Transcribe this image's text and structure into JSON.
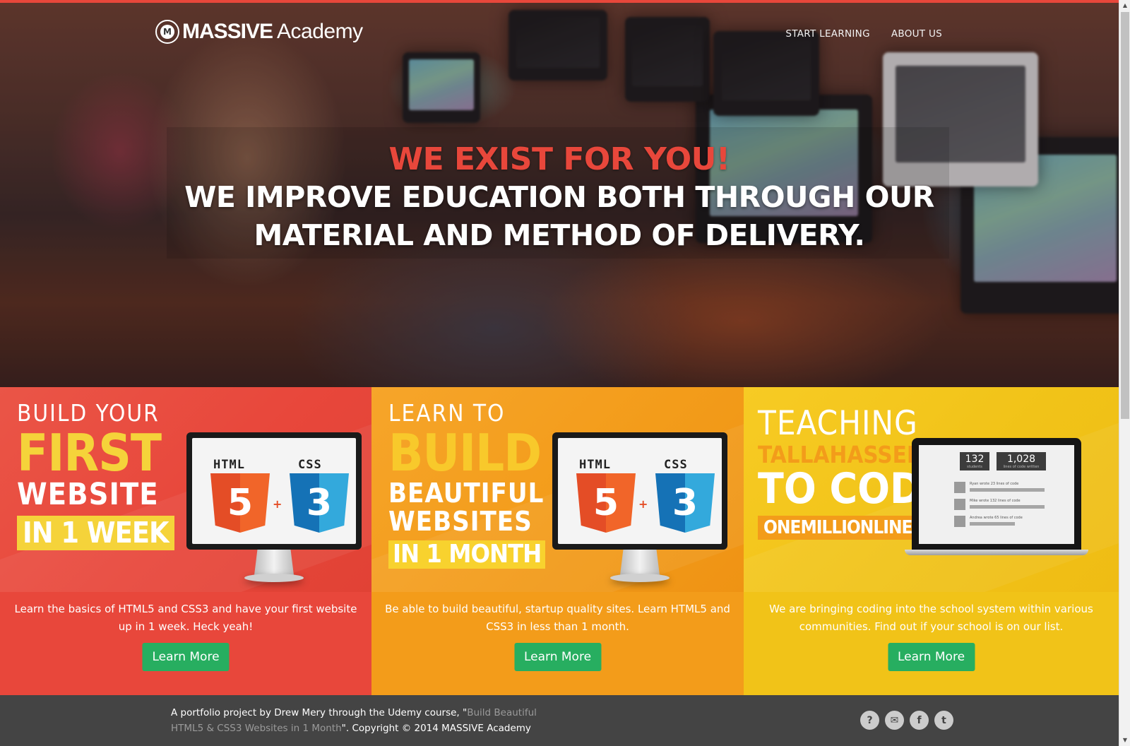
{
  "brand": {
    "strong": "MASSIVE",
    "light": "Academy",
    "emblem": "M"
  },
  "nav": {
    "items": [
      "START LEARNING",
      "ABOUT US"
    ]
  },
  "hero": {
    "title": "WE EXIST FOR YOU!",
    "subtitle_line1": "WE IMPROVE EDUCATION BOTH THROUGH OUR",
    "subtitle_line2": "MATERIAL AND METHOD OF DELIVERY."
  },
  "features": [
    {
      "banner": [
        "BUILD YOUR",
        "FIRST",
        "WEBSITE",
        "IN 1 WEEK"
      ],
      "desc": "Learn the basics of HTML5 and CSS3 and have your first website up in 1 week. Heck yeah!",
      "button": "Learn More",
      "graphic": {
        "html_label": "HTML",
        "css_label": "CSS",
        "html_num": "5",
        "css_num": "3",
        "plus": "+"
      }
    },
    {
      "banner": [
        "LEARN TO",
        "BUILD",
        "BEAUTIFUL",
        "WEBSITES",
        "IN 1 MONTH"
      ],
      "desc": "Be able to build beautiful, startup quality sites. Learn HTML5 and CSS3 in less than 1 month.",
      "button": "Learn More",
      "graphic": {
        "html_label": "HTML",
        "css_label": "CSS",
        "html_num": "5",
        "css_num": "3",
        "plus": "+"
      }
    },
    {
      "banner": [
        "TEACHING",
        "TALLAHASSEE",
        "TO CODE",
        "ONEMILLIONLINES_"
      ],
      "desc": "We are bringing coding into the school system within various communities. Find out if your school is on our list.",
      "button": "Learn More",
      "graphic": {
        "stat1_value": "132",
        "stat1_label": "students",
        "stat2_value": "1,028",
        "stat2_label": "lines of code written",
        "feed": [
          "Ryan wrote 23 lines of code",
          "Mike wrote 132 lines of code",
          "Andrea wrote 65 lines of code"
        ]
      }
    }
  ],
  "footer": {
    "text_before": "A portfolio project by Drew Mery through the Udemy course, \"",
    "link": "Build Beautiful HTML5 & CSS3 Websites in 1 Month",
    "text_after": "\". Copyright © 2014 MASSIVE Academy",
    "social_icons": [
      "question-icon",
      "envelope-icon",
      "facebook-icon",
      "twitter-icon"
    ]
  },
  "colors": {
    "accent_red": "#e8473b",
    "accent_orange": "#f39c1a",
    "accent_yellow": "#f1c318",
    "button_green": "#27ae60",
    "footer_bg": "#444444"
  }
}
